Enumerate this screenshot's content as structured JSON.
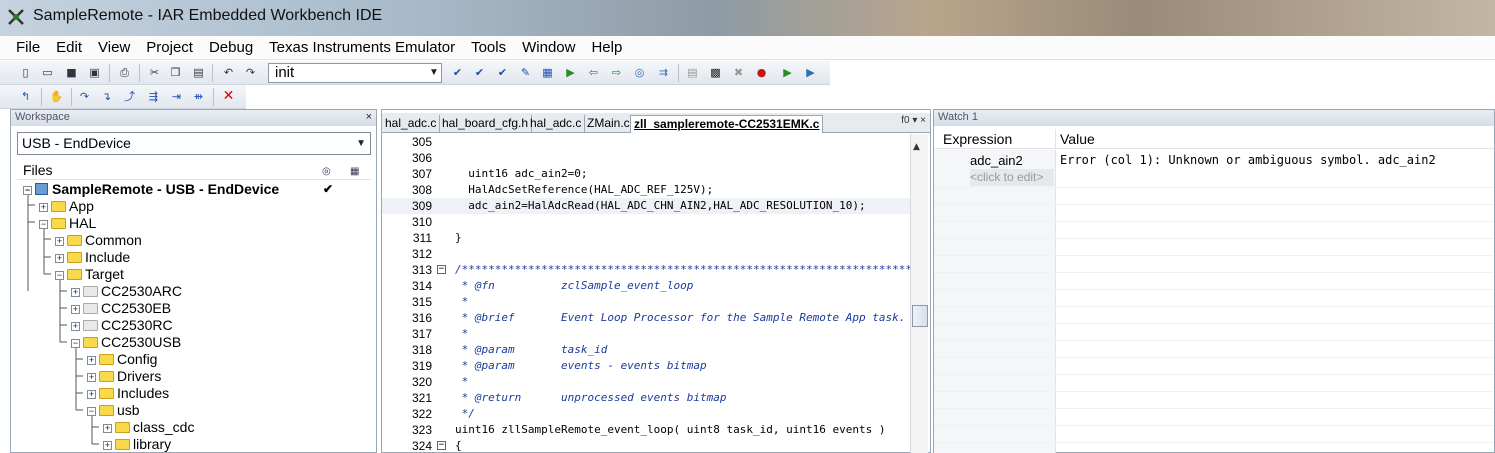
{
  "window": {
    "title": "SampleRemote - IAR Embedded Workbench IDE"
  },
  "menu": [
    "File",
    "Edit",
    "View",
    "Project",
    "Debug",
    "Texas Instruments Emulator",
    "Tools",
    "Window",
    "Help"
  ],
  "toolbar": {
    "config_value": "init"
  },
  "workspace": {
    "title": "Workspace",
    "config": "USB - EndDevice",
    "files_header": "Files",
    "tree": [
      {
        "label": "SampleRemote - USB - EndDevice",
        "type": "project",
        "level": 0,
        "toggle": "−",
        "checked": true
      },
      {
        "label": "App",
        "type": "folder",
        "level": 1,
        "toggle": "+"
      },
      {
        "label": "HAL",
        "type": "folder",
        "level": 1,
        "toggle": "−"
      },
      {
        "label": "Common",
        "type": "folder",
        "level": 2,
        "toggle": "+"
      },
      {
        "label": "Include",
        "type": "folder",
        "level": 2,
        "toggle": "+"
      },
      {
        "label": "Target",
        "type": "folder",
        "level": 2,
        "toggle": "−"
      },
      {
        "label": "CC2530ARC",
        "type": "folder-grey",
        "level": 3,
        "toggle": "+"
      },
      {
        "label": "CC2530EB",
        "type": "folder-grey",
        "level": 3,
        "toggle": "+"
      },
      {
        "label": "CC2530RC",
        "type": "folder-grey",
        "level": 3,
        "toggle": "+"
      },
      {
        "label": "CC2530USB",
        "type": "folder",
        "level": 3,
        "toggle": "−"
      },
      {
        "label": "Config",
        "type": "folder",
        "level": 4,
        "toggle": "+"
      },
      {
        "label": "Drivers",
        "type": "folder",
        "level": 4,
        "toggle": "+"
      },
      {
        "label": "Includes",
        "type": "folder",
        "level": 4,
        "toggle": "+"
      },
      {
        "label": "usb",
        "type": "folder",
        "level": 4,
        "toggle": "−"
      },
      {
        "label": "class_cdc",
        "type": "folder",
        "level": 5,
        "toggle": "+"
      },
      {
        "label": "library",
        "type": "folder",
        "level": 5,
        "toggle": "+"
      }
    ]
  },
  "editor": {
    "tabs": [
      "hal_adc.c",
      "hal_board_cfg.h",
      "hal_adc.c",
      "ZMain.c",
      "zll_sampleremote-CC2531EMK.c"
    ],
    "active_tab": 4,
    "tab_controls": "f0 ▾ ×",
    "lines": [
      {
        "n": "305",
        "t": ""
      },
      {
        "n": "306",
        "t": ""
      },
      {
        "n": "307",
        "t": "  uint16 adc_ain2=0;"
      },
      {
        "n": "308",
        "t": "  HalAdcSetReference(HAL_ADC_REF_125V);"
      },
      {
        "n": "309",
        "t": "  adc_ain2=HalAdcRead(HAL_ADC_CHN_AIN2,HAL_ADC_RESOLUTION_10);",
        "current": true
      },
      {
        "n": "310",
        "t": ""
      },
      {
        "n": "311",
        "t": "}"
      },
      {
        "n": "312",
        "t": ""
      },
      {
        "n": "313",
        "t": "/*********************************************************************",
        "comment": true,
        "fold": "−"
      },
      {
        "n": "314",
        "t": " * @fn          zclSample_event_loop",
        "comment": true
      },
      {
        "n": "315",
        "t": " *",
        "comment": true
      },
      {
        "n": "316",
        "t": " * @brief       Event Loop Processor for the Sample Remote App task.",
        "comment": true
      },
      {
        "n": "317",
        "t": " *",
        "comment": true
      },
      {
        "n": "318",
        "t": " * @param       task_id",
        "comment": true
      },
      {
        "n": "319",
        "t": " * @param       events - events bitmap",
        "comment": true
      },
      {
        "n": "320",
        "t": " *",
        "comment": true
      },
      {
        "n": "321",
        "t": " * @return      unprocessed events bitmap",
        "comment": true
      },
      {
        "n": "322",
        "t": " */",
        "comment": true
      },
      {
        "n": "323",
        "t": "uint16 zllSampleRemote_event_loop( uint8 task_id, uint16 events )"
      },
      {
        "n": "324",
        "t": "{",
        "fold": "−"
      }
    ]
  },
  "watch": {
    "title": "Watch 1",
    "col_expression": "Expression",
    "col_value": "Value",
    "rows": [
      {
        "expr": "adc_ain2",
        "value": "Error (col 1): Unknown or ambiguous symbol. adc_ain2"
      }
    ],
    "edit_placeholder": "<click to edit>"
  }
}
